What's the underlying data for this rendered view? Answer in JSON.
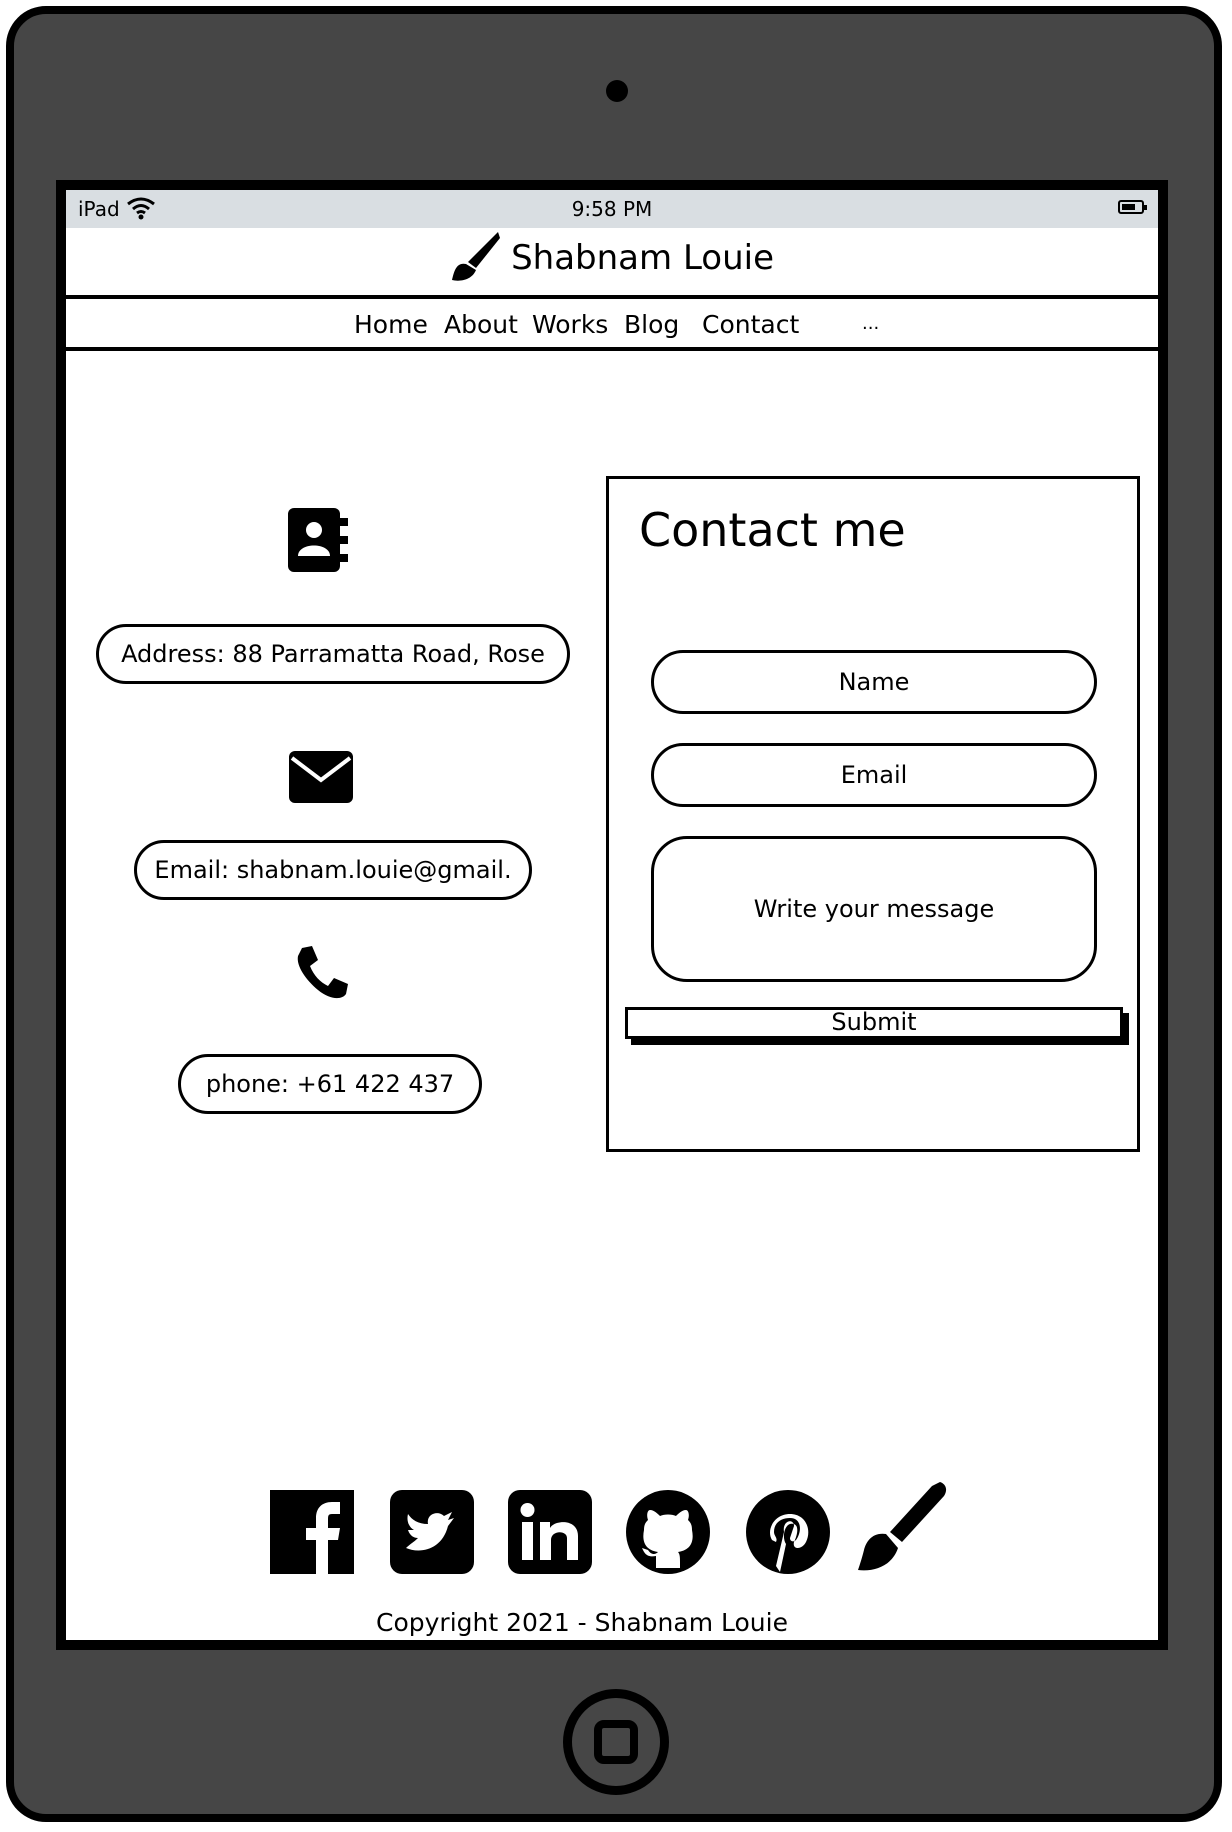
{
  "device": {
    "model_label": "iPad",
    "time": "9:58 PM",
    "battery_level": 0.7
  },
  "brand": {
    "name": "Shabnam Louie",
    "logo_icon": "paintbrush-icon"
  },
  "nav": {
    "items": [
      "Home",
      "About",
      "Works",
      "Blog",
      "Contact",
      "..."
    ]
  },
  "contact_info": {
    "address_icon": "address-book-icon",
    "address": "Address: 88 Parramatta Road, Rose",
    "email_icon": "envelope-icon",
    "email": "Email: shabnam.louie@gmail.",
    "phone_icon": "phone-icon",
    "phone": "phone: +61 422 437"
  },
  "form": {
    "title": "Contact me",
    "name_placeholder": "Name",
    "email_placeholder": "Email",
    "message_placeholder": "Write your message",
    "submit_label": "Submit"
  },
  "social": {
    "icons": [
      "facebook-icon",
      "twitter-icon",
      "linkedin-icon",
      "github-icon",
      "pinterest-icon",
      "paintbrush-icon"
    ]
  },
  "footer": {
    "copyright": "Copyright  2021 - Shabnam Louie"
  }
}
